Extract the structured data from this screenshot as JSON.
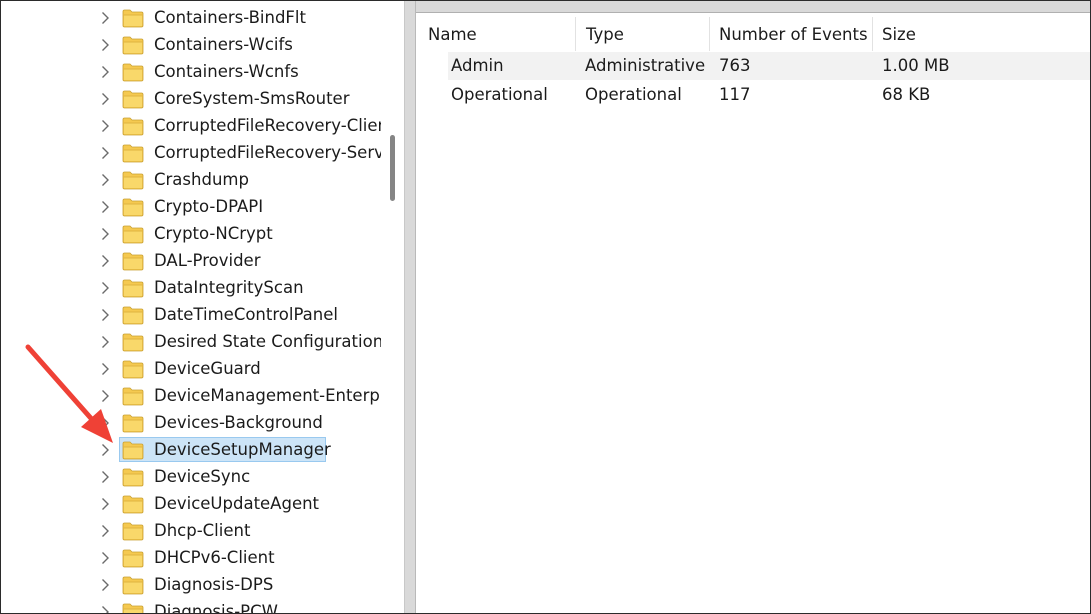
{
  "tree": {
    "items": [
      {
        "label": "Containers-BindFlt"
      },
      {
        "label": "Containers-Wcifs"
      },
      {
        "label": "Containers-Wcnfs"
      },
      {
        "label": "CoreSystem-SmsRouter"
      },
      {
        "label": "CorruptedFileRecovery-Client"
      },
      {
        "label": "CorruptedFileRecovery-Server"
      },
      {
        "label": "Crashdump"
      },
      {
        "label": "Crypto-DPAPI"
      },
      {
        "label": "Crypto-NCrypt"
      },
      {
        "label": "DAL-Provider"
      },
      {
        "label": "DataIntegrityScan"
      },
      {
        "label": "DateTimeControlPanel"
      },
      {
        "label": "Desired State Configuration"
      },
      {
        "label": "DeviceGuard"
      },
      {
        "label": "DeviceManagement-Enterprise"
      },
      {
        "label": "Devices-Background"
      },
      {
        "label": "DeviceSetupManager",
        "selected": true
      },
      {
        "label": "DeviceSync"
      },
      {
        "label": "DeviceUpdateAgent"
      },
      {
        "label": "Dhcp-Client"
      },
      {
        "label": "DHCPv6-Client"
      },
      {
        "label": "Diagnosis-DPS"
      },
      {
        "label": "Diagnosis-PCW"
      }
    ]
  },
  "log_table": {
    "columns": [
      "Name",
      "Type",
      "Number of Events",
      "Size"
    ],
    "rows": [
      {
        "name": "Admin",
        "type": "Administrative",
        "events": "763",
        "size": "1.00 MB"
      },
      {
        "name": "Operational",
        "type": "Operational",
        "events": "117",
        "size": "68 KB"
      }
    ]
  },
  "colors": {
    "selection_fill": "#cce4f7",
    "selection_border": "#99c9ef",
    "folder_yellow": "#f5c950",
    "annotation_arrow": "#ef4136"
  }
}
